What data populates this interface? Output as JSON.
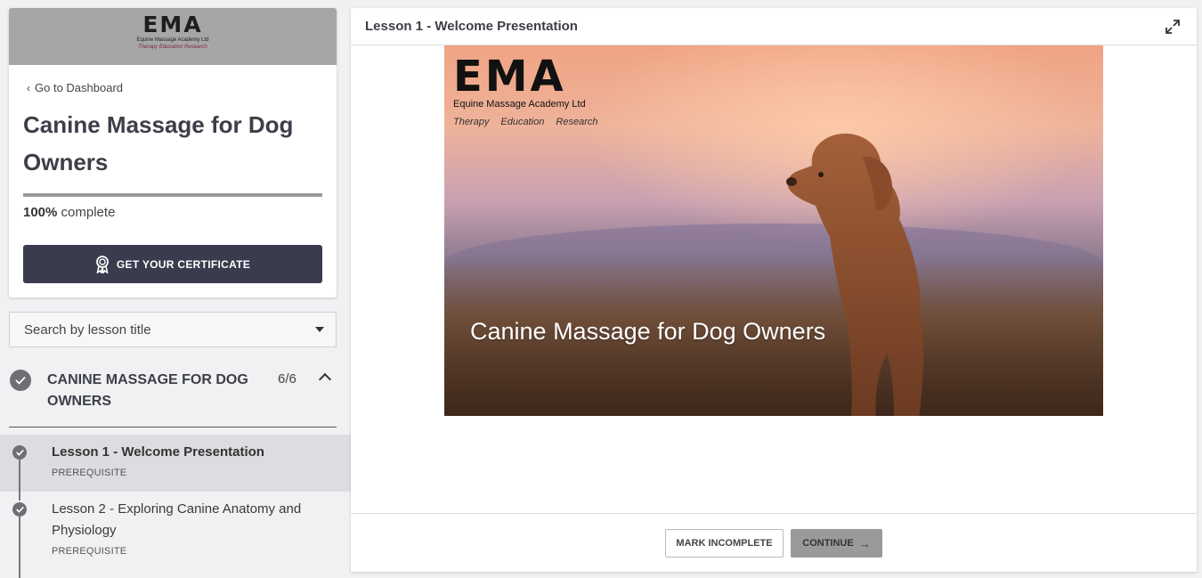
{
  "sidebar": {
    "logo": {
      "text": "EMA",
      "subtitle": "Equine Massage Academy Ltd",
      "tagline": "Therapy  Education  Research"
    },
    "back_link": "Go to Dashboard",
    "course_title": "Canine Massage for Dog Owners",
    "progress": {
      "percent_value": 100,
      "percent_label": "100%",
      "suffix": "complete"
    },
    "certificate_button": "GET YOUR CERTIFICATE",
    "search": {
      "placeholder": "Search by lesson title"
    },
    "chapter": {
      "title": "CANINE MASSAGE FOR DOG OWNERS",
      "count": "6/6",
      "completed": true,
      "expanded": true
    },
    "lessons": [
      {
        "title": "Lesson 1 - Welcome Presentation",
        "tag": "PREREQUISITE",
        "completed": true,
        "active": true
      },
      {
        "title": "Lesson 2 - Exploring Canine Anatomy and Physiology",
        "tag": "PREREQUISITE",
        "completed": true,
        "active": false
      }
    ]
  },
  "main": {
    "lesson_heading": "Lesson 1 - Welcome Presentation",
    "media": {
      "logo_text": "EMA",
      "logo_subtitle": "Equine Massage Academy Ltd",
      "logo_tagline": "Therapy Education Research",
      "title": "Canine Massage for Dog Owners"
    },
    "footer": {
      "mark_incomplete": "MARK INCOMPLETE",
      "continue": "CONTINUE"
    }
  },
  "colors": {
    "dark_button": "#3a3c4e",
    "check_gray": "#6d6f74",
    "active_lesson_bg": "#dcdde0",
    "continue_bg": "#9a9a9a"
  },
  "icons": [
    "chevron-left-icon",
    "award-icon",
    "caret-down-icon",
    "check-icon",
    "chevron-up-icon",
    "expand-icon",
    "arrow-right-icon"
  ]
}
